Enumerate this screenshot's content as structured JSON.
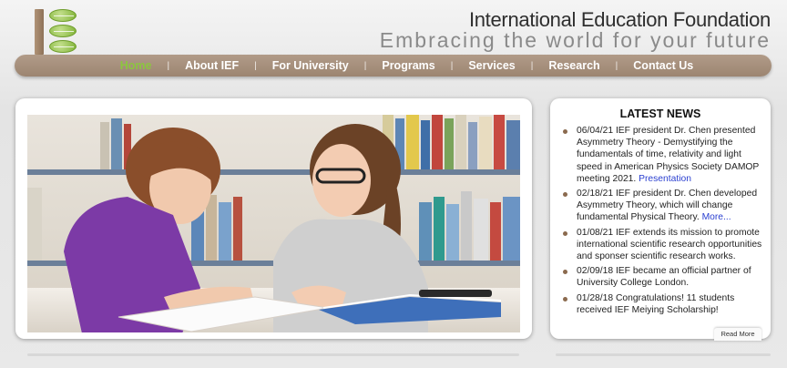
{
  "header": {
    "org_name": "International Education Foundation",
    "tagline": "Embracing the world for your future"
  },
  "nav": {
    "items": [
      {
        "label": "Home",
        "active": true
      },
      {
        "label": "About IEF"
      },
      {
        "label": "For University"
      },
      {
        "label": "Programs"
      },
      {
        "label": "Services"
      },
      {
        "label": "Research"
      },
      {
        "label": "Contact Us"
      }
    ],
    "separator": "|"
  },
  "news": {
    "title": "LATEST NEWS",
    "items": [
      {
        "text": "06/04/21 IEF president Dr. Chen presented Asymmetry Theory - Demystifying the fundamentals of time, relativity and light speed in American Physics Society DAMOP meeting 2021. ",
        "link": "Presentation"
      },
      {
        "text": "02/18/21 IEF president Dr. Chen developed Asymmetry Theory, which will change fundamental Physical Theory. ",
        "link": "More..."
      },
      {
        "text": "01/08/21 IEF extends its mission to promote international scientific research opportunities and sponser scientific research works.",
        "link": ""
      },
      {
        "text": "02/09/18 IEF became an official partner of University College London.",
        "link": ""
      },
      {
        "text": "01/28/18 Congratulations! 11 students received IEF Meiying Scholarship!",
        "link": ""
      }
    ],
    "read_more": "Read More"
  },
  "colors": {
    "nav_bg": "#a48e7a",
    "nav_active": "#8cc63f",
    "link": "#2a3fd0",
    "bullet": "#8b6a4e"
  }
}
